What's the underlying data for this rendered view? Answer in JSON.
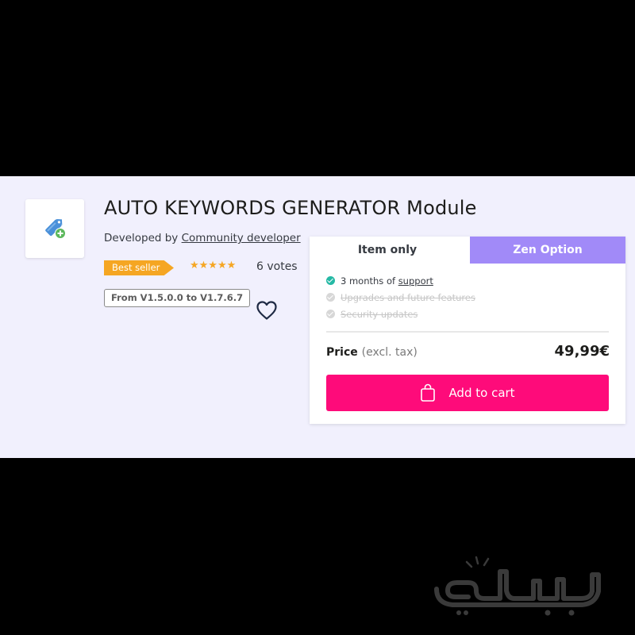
{
  "product": {
    "title": "AUTO KEYWORDS GENERATOR Module",
    "developed_by_label": "Developed by",
    "developer": "Community developer",
    "badge": "Best seller",
    "stars": "★★★★★",
    "rating": 5,
    "votes": "6 votes",
    "compatibility": "From V1.5.0.0 to V1.7.6.7",
    "icon": "tag-add-icon"
  },
  "purchase": {
    "tabs": [
      {
        "label": "Item only",
        "active": true
      },
      {
        "label": "Zen Option",
        "active": false
      }
    ],
    "features": [
      {
        "prefix": "3 months of ",
        "link": "support",
        "included": true
      },
      {
        "text": "Upgrades and future features",
        "included": false
      },
      {
        "text": "Security updates",
        "included": false
      }
    ],
    "price_label": "Price",
    "price_note": "(excl. tax)",
    "price": "49,99€",
    "cart_label": "Add to cart"
  },
  "colors": {
    "band_bg": "#f1f0fd",
    "badge": "#f5a623",
    "zen_tab": "#a18af8",
    "cart_button": "#fe0b7a",
    "check": "#25b9a5"
  },
  "watermark": {
    "text": "بابساطی"
  }
}
